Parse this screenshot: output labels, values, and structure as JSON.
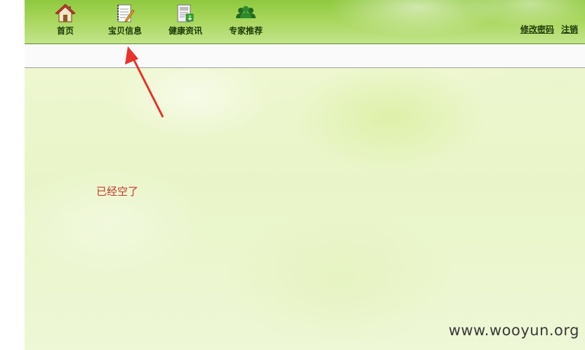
{
  "nav": {
    "items": [
      {
        "label": "首页",
        "icon": "home-icon"
      },
      {
        "label": "宝贝信息",
        "icon": "notepad-icon"
      },
      {
        "label": "健康资讯",
        "icon": "news-icon"
      },
      {
        "label": "专家推荐",
        "icon": "users-icon"
      }
    ]
  },
  "user_links": {
    "change_password": "修改密码",
    "logout": "注销"
  },
  "content": {
    "empty_message": "已经空了"
  },
  "watermark": "www.wooyun.org",
  "colors": {
    "header_green": "#a8d65c",
    "message_red": "#c0392b",
    "annotation_arrow": "#e8322a"
  }
}
